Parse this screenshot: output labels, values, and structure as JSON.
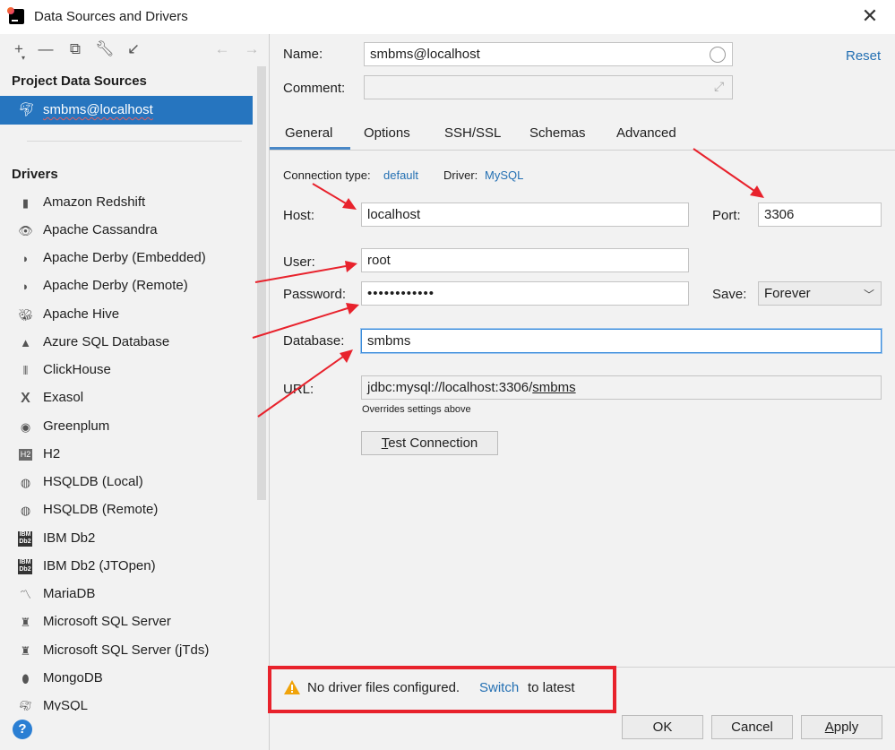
{
  "window": {
    "title": "Data Sources and Drivers"
  },
  "left_panel": {
    "project_section_title": "Project Data Sources",
    "selected_source": "smbms@localhost",
    "drivers_section_title": "Drivers",
    "drivers": [
      "Amazon Redshift",
      "Apache Cassandra",
      "Apache Derby (Embedded)",
      "Apache Derby (Remote)",
      "Apache Hive",
      "Azure SQL Database",
      "ClickHouse",
      "Exasol",
      "Greenplum",
      "H2",
      "HSQLDB (Local)",
      "HSQLDB (Remote)",
      "IBM Db2",
      "IBM Db2 (JTOpen)",
      "MariaDB",
      "Microsoft SQL Server",
      "Microsoft SQL Server (jTds)",
      "MongoDB",
      "MySQL"
    ],
    "help_label": "?"
  },
  "form": {
    "name_label": "Name:",
    "name_value": "smbms@localhost",
    "reset_label": "Reset",
    "comment_label": "Comment:",
    "comment_value": "",
    "tabs": [
      "General",
      "Options",
      "SSH/SSL",
      "Schemas",
      "Advanced"
    ],
    "active_tab": "General",
    "connection_type_label": "Connection type:",
    "connection_type_value": "default",
    "driver_label": "Driver:",
    "driver_value": "MySQL",
    "host_label": "Host:",
    "host_value": "localhost",
    "port_label": "Port:",
    "port_value": "3306",
    "user_label": "User:",
    "user_value": "root",
    "password_label": "Password:",
    "password_value": "••••••••••••",
    "save_label": "Save:",
    "save_value": "Forever",
    "database_label": "Database:",
    "database_value": "smbms",
    "url_label": "URL:",
    "url_prefix": "jdbc:mysql://localhost:3306/",
    "url_db": "smbms",
    "url_hint": "Overrides settings above",
    "test_connection_prefix": "T",
    "test_connection_rest": "est Connection"
  },
  "banner": {
    "message": "No driver files configured.",
    "link": "Switch",
    "suffix": "to latest"
  },
  "footer": {
    "ok": "OK",
    "cancel": "Cancel",
    "apply_prefix": "A",
    "apply_rest": "pply"
  },
  "colors": {
    "selection": "#2675bf",
    "link": "#2470b3",
    "annotation_red": "#e8222c"
  }
}
